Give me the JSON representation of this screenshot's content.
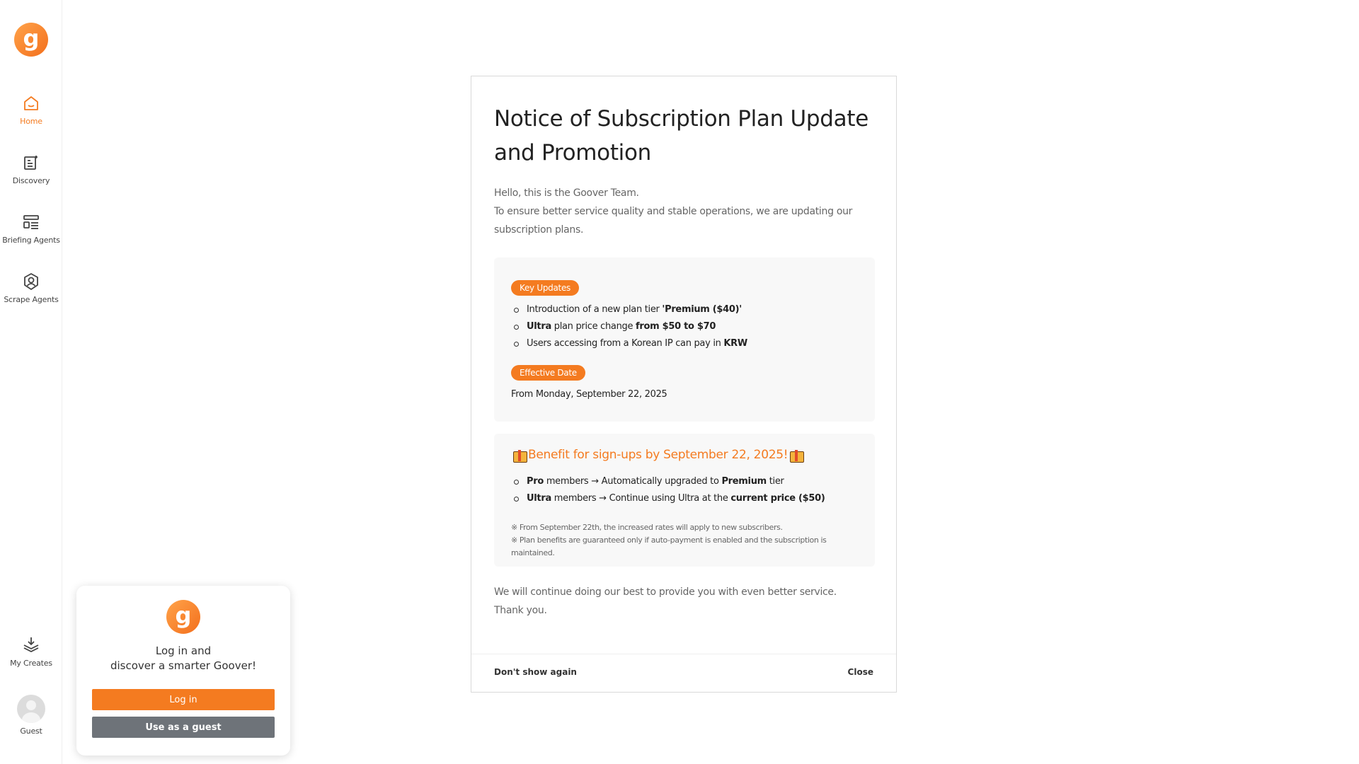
{
  "sidebar": {
    "logo_letter": "g",
    "nav": [
      {
        "label": "Home",
        "icon": "home-icon",
        "active": true
      },
      {
        "label": "Discovery",
        "icon": "discovery-icon"
      },
      {
        "label": "Briefing Agents",
        "icon": "briefing-icon"
      },
      {
        "label": "Scrape Agents",
        "icon": "scrape-icon"
      }
    ],
    "bottom": {
      "my_creates": "My Creates",
      "guest": "Guest"
    }
  },
  "login_card": {
    "line1": "Log in and",
    "line2": "discover a smarter Goover!",
    "login_label": "Log in",
    "guest_label": "Use as a guest"
  },
  "modal": {
    "title": "Notice of Subscription Plan Update and Promotion",
    "intro_line1": "Hello, this is the Goover Team.",
    "intro_line2": "To ensure better service quality and stable operations, we are updating our subscription plans.",
    "key_updates_badge": "Key Updates",
    "updates": {
      "u1_pre": "Introduction of a new plan tier ",
      "u1_bold": "'Premium ($40)'",
      "u2_b1": "Ultra",
      "u2_mid": " plan price change ",
      "u2_b2": "from $50 to $70",
      "u3_pre": "Users accessing from a Korean IP can pay in ",
      "u3_bold": "KRW"
    },
    "effective_badge": "Effective Date",
    "effective_text": "From Monday, September 22, 2025",
    "benefit_title": "Benefit for sign-ups by September 22, 2025!",
    "benefits": {
      "b1_b1": "Pro",
      "b1_mid": " members → Automatically upgraded to ",
      "b1_b2": "Premium",
      "b1_post": " tier",
      "b2_b1": "Ultra",
      "b2_mid": " members → Continue using Ultra at the ",
      "b2_b2": "current price ($50)"
    },
    "note1": "※ From September 22th, the increased rates will apply to new subscribers.",
    "note2": "※ Plan benefits are guaranteed only if auto-payment is enabled and the subscription is maintained.",
    "closing_line1": "We will continue doing our best to provide you with even better service.",
    "closing_line2": "Thank you.",
    "dont_show": "Don't show again",
    "close": "Close"
  },
  "colors": {
    "accent": "#f47b20",
    "guest_button": "#6e7379"
  }
}
